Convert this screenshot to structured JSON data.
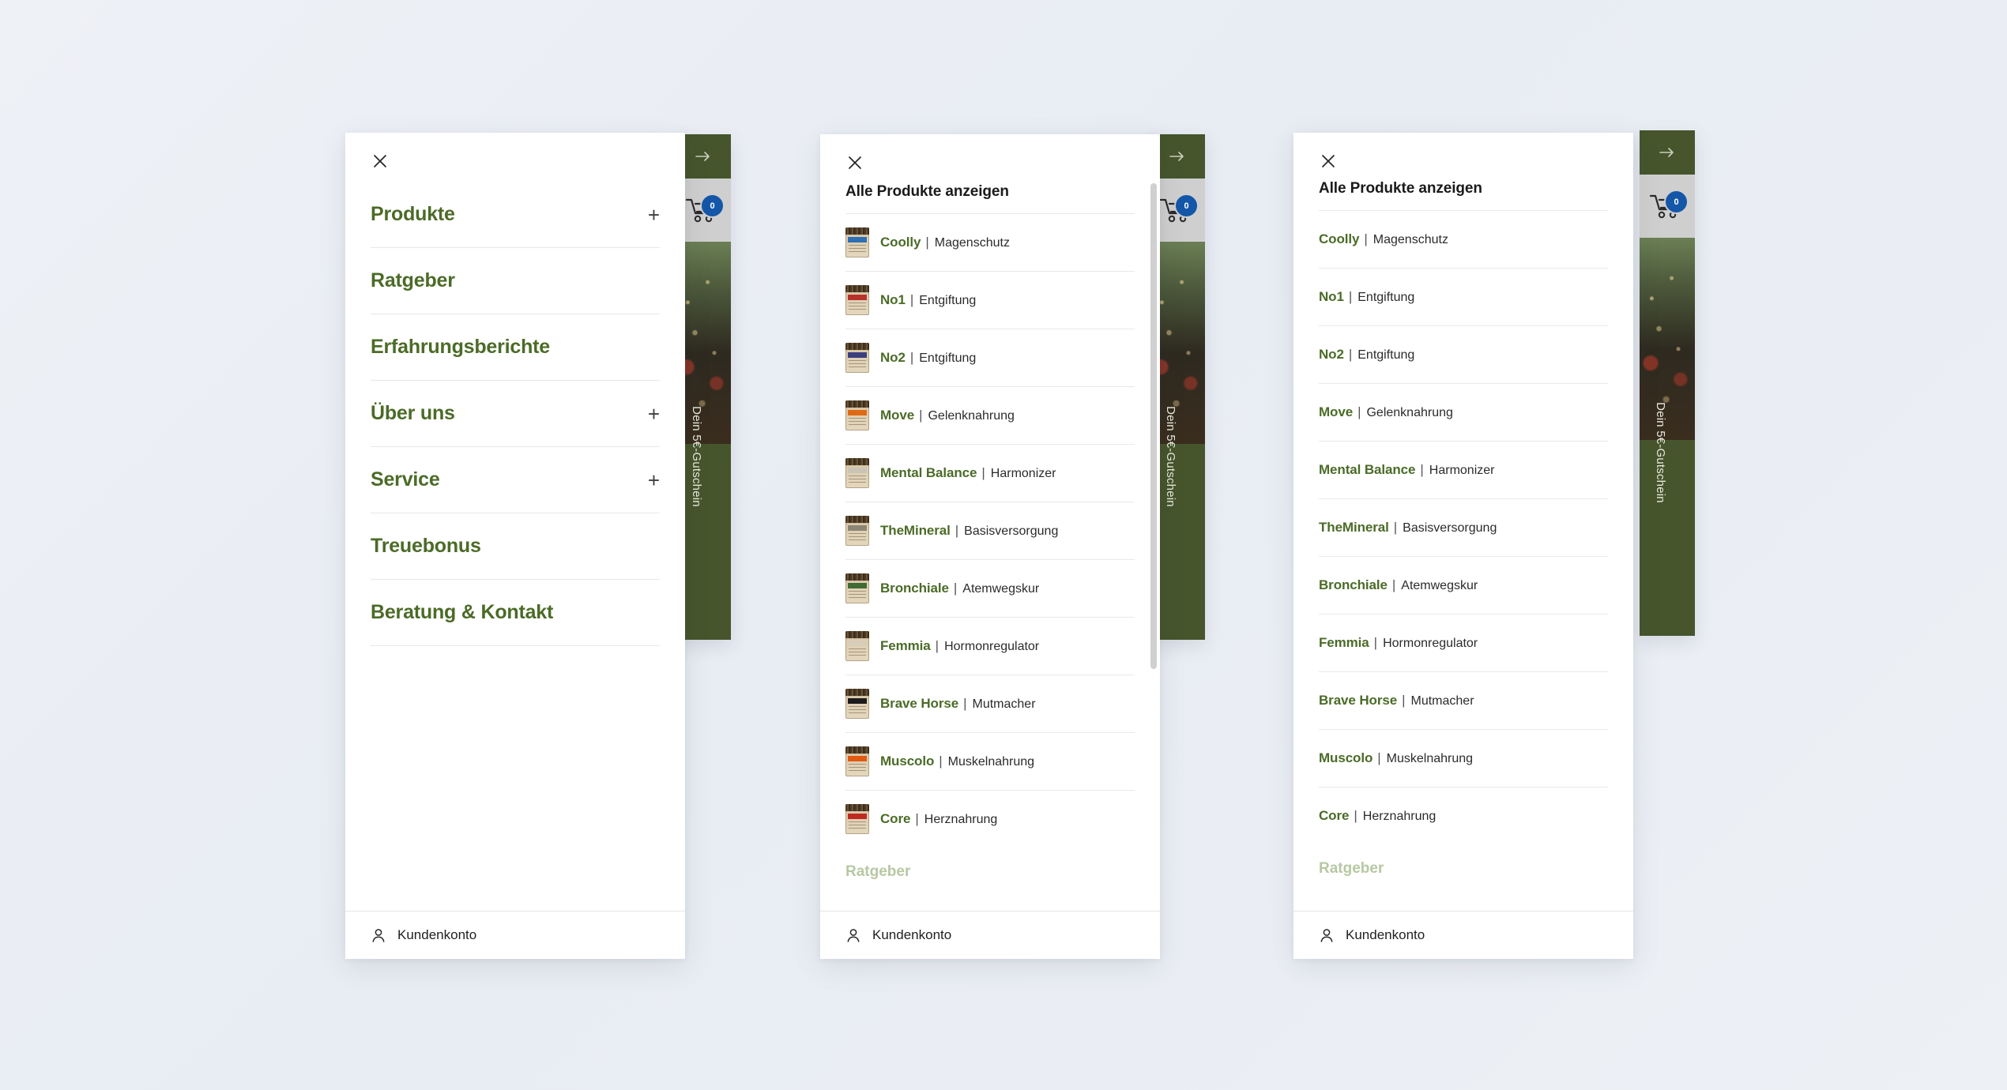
{
  "theme": {
    "brand_green": "#46552c",
    "link_green": "#4b6b27",
    "badge_blue": "#1457a8",
    "page_background": "#eef1f6"
  },
  "rail": {
    "arrow_icon": "arrow-right-icon",
    "cart_icon": "shopping-cart-icon",
    "cart_count": "0",
    "coupon_text": "Dein 5€-Gutschein"
  },
  "panels": [
    {
      "id": "main-menu",
      "close_label": "×",
      "menu_items": [
        {
          "label": "Produkte",
          "expand": "+"
        },
        {
          "label": "Ratgeber",
          "expand": ""
        },
        {
          "label": "Erfahrungsberichte",
          "expand": ""
        },
        {
          "label": "Über uns",
          "expand": "+"
        },
        {
          "label": "Service",
          "expand": "+"
        },
        {
          "label": "Treuebonus",
          "expand": ""
        },
        {
          "label": "Beratung & Kontakt",
          "expand": ""
        }
      ]
    },
    {
      "id": "products-with-icons",
      "close_label": "×",
      "title": "Alle Produkte anzeigen",
      "footer_title": "Ratgeber",
      "products": [
        {
          "name": "Coolly",
          "sep": "|",
          "desc": "Magenschutz",
          "swatch": "#2f6fb5"
        },
        {
          "name": "No1",
          "sep": "|",
          "desc": "Entgiftung",
          "swatch": "#b8322c"
        },
        {
          "name": "No2",
          "sep": "|",
          "desc": "Entgiftung",
          "swatch": "#3c3f7d"
        },
        {
          "name": "Move",
          "sep": "|",
          "desc": "Gelenknahrung",
          "swatch": "#e06a14"
        },
        {
          "name": "Mental Balance",
          "sep": "|",
          "desc": "Harmonizer",
          "swatch": "#c9c4b6"
        },
        {
          "name": "TheMineral",
          "sep": "|",
          "desc": "Basisversorgung",
          "swatch": "#8a8575"
        },
        {
          "name": "Bronchiale",
          "sep": "|",
          "desc": "Atemwegskur",
          "swatch": "#3f6b33"
        },
        {
          "name": "Femmia",
          "sep": "|",
          "desc": "Hormonregulator",
          "swatch": "#d8cdb8"
        },
        {
          "name": "Brave Horse",
          "sep": "|",
          "desc": "Mutmacher",
          "swatch": "#1c1c1c"
        },
        {
          "name": "Muscolo",
          "sep": "|",
          "desc": "Muskelnahrung",
          "swatch": "#e05a12"
        },
        {
          "name": "Core",
          "sep": "|",
          "desc": "Herznahrung",
          "swatch": "#c02a22"
        }
      ]
    },
    {
      "id": "products-no-icons",
      "close_label": "×",
      "title": "Alle Produkte anzeigen",
      "footer_title": "Ratgeber",
      "products": [
        {
          "name": "Coolly",
          "sep": "|",
          "desc": "Magenschutz"
        },
        {
          "name": "No1",
          "sep": "|",
          "desc": "Entgiftung"
        },
        {
          "name": "No2",
          "sep": "|",
          "desc": "Entgiftung"
        },
        {
          "name": "Move",
          "sep": "|",
          "desc": "Gelenknahrung"
        },
        {
          "name": "Mental Balance",
          "sep": "|",
          "desc": "Harmonizer"
        },
        {
          "name": "TheMineral",
          "sep": "|",
          "desc": "Basisversorgung"
        },
        {
          "name": "Bronchiale",
          "sep": "|",
          "desc": "Atemwegskur"
        },
        {
          "name": "Femmia",
          "sep": "|",
          "desc": "Hormonregulator"
        },
        {
          "name": "Brave Horse",
          "sep": "|",
          "desc": "Mutmacher"
        },
        {
          "name": "Muscolo",
          "sep": "|",
          "desc": "Muskelnahrung"
        },
        {
          "name": "Core",
          "sep": "|",
          "desc": "Herznahrung"
        }
      ]
    }
  ],
  "account": {
    "icon": "user-icon",
    "label": "Kundenkonto"
  }
}
